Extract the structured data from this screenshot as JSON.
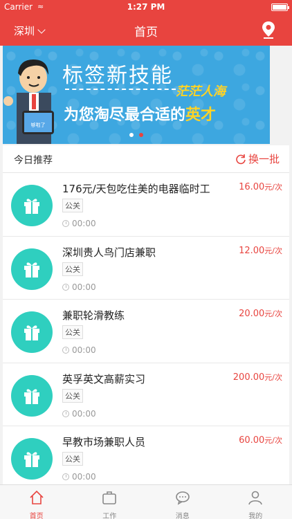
{
  "status": {
    "carrier": "Carrier",
    "time": "1:27 PM"
  },
  "nav": {
    "city": "深圳",
    "title": "首页"
  },
  "banner": {
    "line1": "标签新技能",
    "line2": "茫茫人海",
    "line3a": "为您淘尽最合适的",
    "line3b": "英才",
    "mascot_screen_text": "够啦了",
    "slides": 2,
    "active_slide": 2
  },
  "section": {
    "label": "今日推荐",
    "refresh_label": "换一批"
  },
  "jobs": [
    {
      "title": "176元/天包吃住美的电器临时工",
      "tag": "公关",
      "time": "00:00",
      "price": "16.00",
      "unit": "元/次"
    },
    {
      "title": "深圳贵人鸟门店兼职",
      "tag": "公关",
      "time": "00:00",
      "price": "12.00",
      "unit": "元/次"
    },
    {
      "title": "兼职轮滑教练",
      "tag": "公关",
      "time": "00:00",
      "price": "20.00",
      "unit": "元/次"
    },
    {
      "title": "英孚英文高薪实习",
      "tag": "公关",
      "time": "00:00",
      "price": "200.00",
      "unit": "元/次"
    },
    {
      "title": "早教市场兼职人员",
      "tag": "公关",
      "time": "00:00",
      "price": "60.00",
      "unit": "元/次"
    }
  ],
  "tabs": [
    {
      "label": "首页",
      "icon": "home-icon",
      "active": true
    },
    {
      "label": "工作",
      "icon": "briefcase-icon",
      "active": false
    },
    {
      "label": "消息",
      "icon": "chat-icon",
      "active": false
    },
    {
      "label": "我的",
      "icon": "user-icon",
      "active": false
    }
  ],
  "colors": {
    "brand": "#e8443f",
    "gift": "#2fcfbf",
    "banner": "#3da7e0",
    "highlight": "#ffd326"
  }
}
